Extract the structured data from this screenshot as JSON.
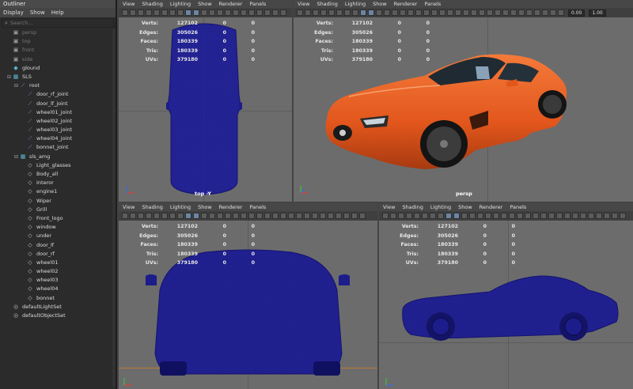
{
  "outliner": {
    "title": "Outliner",
    "menu": [
      "Display",
      "Show",
      "Help"
    ],
    "search_placeholder": "Search...",
    "items": [
      {
        "label": "persp",
        "icon": "camera-icon",
        "depth": 0,
        "dim": true,
        "expander": ""
      },
      {
        "label": "top",
        "icon": "camera-icon",
        "depth": 0,
        "dim": true,
        "expander": ""
      },
      {
        "label": "front",
        "icon": "camera-icon",
        "depth": 0,
        "dim": true,
        "expander": ""
      },
      {
        "label": "side",
        "icon": "camera-icon",
        "depth": 0,
        "dim": true,
        "expander": ""
      },
      {
        "label": "glound",
        "icon": "geometry-icon",
        "depth": 0,
        "dim": false,
        "expander": ""
      },
      {
        "label": "SLS",
        "icon": "group-icon",
        "depth": 0,
        "dim": false,
        "expander": "⊟"
      },
      {
        "label": "root",
        "icon": "joint-icon",
        "depth": 1,
        "dim": false,
        "expander": "⊟"
      },
      {
        "label": "door_rf_joint",
        "icon": "joint-icon",
        "depth": 2,
        "dim": false,
        "expander": ""
      },
      {
        "label": "door_lf_joint",
        "icon": "joint-icon",
        "depth": 2,
        "dim": false,
        "expander": ""
      },
      {
        "label": "wheel01_joint",
        "icon": "joint-icon",
        "depth": 2,
        "dim": false,
        "expander": ""
      },
      {
        "label": "wheel02_joint",
        "icon": "joint-icon",
        "depth": 2,
        "dim": false,
        "expander": ""
      },
      {
        "label": "wheel03_joint",
        "icon": "joint-icon",
        "depth": 2,
        "dim": false,
        "expander": ""
      },
      {
        "label": "wheel04_joint",
        "icon": "joint-icon",
        "depth": 2,
        "dim": false,
        "expander": ""
      },
      {
        "label": "bonnet_joint",
        "icon": "joint-icon",
        "depth": 2,
        "dim": false,
        "expander": ""
      },
      {
        "label": "sls_amg",
        "icon": "group-icon",
        "depth": 1,
        "dim": false,
        "expander": "⊟"
      },
      {
        "label": "Light_glasses",
        "icon": "mesh-icon",
        "depth": 2,
        "dim": false,
        "expander": ""
      },
      {
        "label": "Body_all",
        "icon": "mesh-icon",
        "depth": 2,
        "dim": false,
        "expander": ""
      },
      {
        "label": "Interor",
        "icon": "mesh-icon",
        "depth": 2,
        "dim": false,
        "expander": ""
      },
      {
        "label": "engine1",
        "icon": "mesh-icon",
        "depth": 2,
        "dim": false,
        "expander": ""
      },
      {
        "label": "Wiper",
        "icon": "mesh-icon",
        "depth": 2,
        "dim": false,
        "expander": ""
      },
      {
        "label": "Grill",
        "icon": "mesh-icon",
        "depth": 2,
        "dim": false,
        "expander": ""
      },
      {
        "label": "Front_logo",
        "icon": "mesh-icon",
        "depth": 2,
        "dim": false,
        "expander": ""
      },
      {
        "label": "window",
        "icon": "mesh-icon",
        "depth": 2,
        "dim": false,
        "expander": ""
      },
      {
        "label": "under",
        "icon": "mesh-icon",
        "depth": 2,
        "dim": false,
        "expander": ""
      },
      {
        "label": "door_lf",
        "icon": "mesh-icon",
        "depth": 2,
        "dim": false,
        "expander": ""
      },
      {
        "label": "door_rf",
        "icon": "mesh-icon",
        "depth": 2,
        "dim": false,
        "expander": ""
      },
      {
        "label": "wheel01",
        "icon": "mesh-icon",
        "depth": 2,
        "dim": false,
        "expander": ""
      },
      {
        "label": "wheel02",
        "icon": "mesh-icon",
        "depth": 2,
        "dim": false,
        "expander": ""
      },
      {
        "label": "wheel03",
        "icon": "mesh-icon",
        "depth": 2,
        "dim": false,
        "expander": ""
      },
      {
        "label": "wheel04",
        "icon": "mesh-icon",
        "depth": 2,
        "dim": false,
        "expander": ""
      },
      {
        "label": "bonnet",
        "icon": "mesh-icon",
        "depth": 2,
        "dim": false,
        "expander": ""
      },
      {
        "label": "defaultLightSet",
        "icon": "set-icon",
        "depth": 0,
        "dim": false,
        "expander": ""
      },
      {
        "label": "defaultObjectSet",
        "icon": "set-icon",
        "depth": 0,
        "dim": false,
        "expander": ""
      }
    ]
  },
  "viewport_menu": [
    "View",
    "Shading",
    "Lighting",
    "Show",
    "Renderer",
    "Panels"
  ],
  "toolbar": {
    "field1": "0.00",
    "field2": "1.00"
  },
  "hud": {
    "labels": [
      "Verts:",
      "Edges:",
      "Faces:",
      "Tris:",
      "UVs:"
    ],
    "values": [
      "127102",
      "305026",
      "180339",
      "180339",
      "379180"
    ],
    "col2": [
      "0",
      "0",
      "0",
      "0",
      "0"
    ],
    "col3": [
      "0",
      "0",
      "0",
      "0",
      "0"
    ]
  },
  "viewports": {
    "top": {
      "camera": "top -Y"
    },
    "persp": {
      "camera": "persp"
    },
    "front": {
      "camera": ""
    },
    "side": {
      "camera": ""
    }
  },
  "colors": {
    "wire": "#1c1c8a",
    "car_body": "#e2561c",
    "viewport_bg": "#6c6c6c",
    "outliner_bg": "#2b2b2b"
  }
}
